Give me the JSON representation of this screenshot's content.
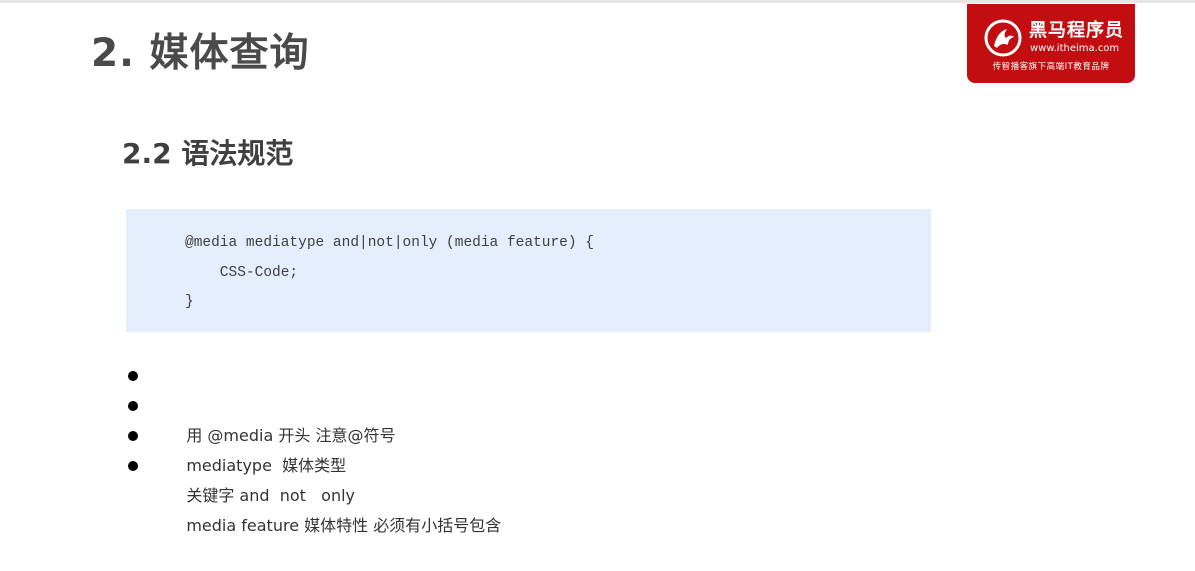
{
  "slide": {
    "title": "2. 媒体查询",
    "subtitle": "2.2 语法规范"
  },
  "logo": {
    "name": "黑马程序员",
    "url": "www.itheima.com",
    "tagline": "传智播客旗下高端IT教育品牌"
  },
  "code": {
    "lines": [
      "@media mediatype and|not|only (media feature) {",
      "    CSS-Code;",
      "}"
    ]
  },
  "bullets": [
    "用 @media 开头 注意@符号",
    "mediatype  媒体类型",
    "关键字 and  not   only",
    "media feature 媒体特性 必须有小括号包含"
  ],
  "colors": {
    "brand": "#c20d11",
    "code_background": "#e4eefd",
    "title_text": "#4a4a4a"
  }
}
